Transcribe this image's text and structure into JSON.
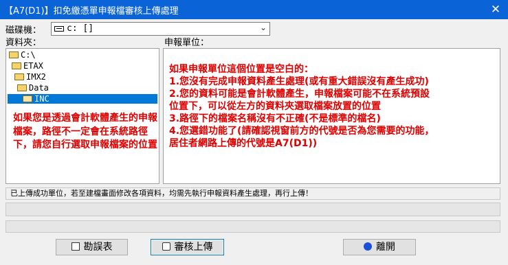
{
  "window": {
    "title": "【A7(D1)】扣免繳憑單申報檔審核上傳處理",
    "close_glyph": "✕"
  },
  "drive": {
    "label": "磁碟機：",
    "value": "c: []",
    "arrow": "⌄"
  },
  "folder": {
    "label": "資料夾：",
    "items": [
      "C:\\",
      "ETAX",
      "IMX2",
      "Data",
      "INC"
    ],
    "selected_index": 4,
    "note": "如果您是透過會計軟體產生的申報檔案，路徑不一定會在系統路徑下，請您自行選取申報檔案的位置"
  },
  "unit": {
    "label": "申報單位：",
    "note_lines": [
      "如果申報單位這個位置是空白的：",
      "1.您沒有完成申報資料產生處理(或有重大錯誤沒有產生成功)",
      "2.您的資料可能是會計軟體產生，申報檔案可能不在系統預設",
      "位置下，可以從左方的資料夾選取檔案放置的位置",
      "3.路徑下的檔案名稱沒有不正確(不是標準的檔名)",
      "4.您選錯功能了(請確認視窗前方的代號是否為您需要的功能，",
      "居住者網路上傳的代號是A7(D1))"
    ]
  },
  "status": {
    "message": "已上傳成功單位，若至建檔畫面修改各項資料，均需先執行申報資料產生處理，再行上傳！",
    "detail": "",
    "progress": 0
  },
  "buttons": {
    "errors_label": "勘誤表",
    "review_label": "審核上傳",
    "exit_label": "離開"
  },
  "colors": {
    "titlebar": "#0a64d8",
    "note_text": "#e00000",
    "selection": "#0078d7"
  }
}
